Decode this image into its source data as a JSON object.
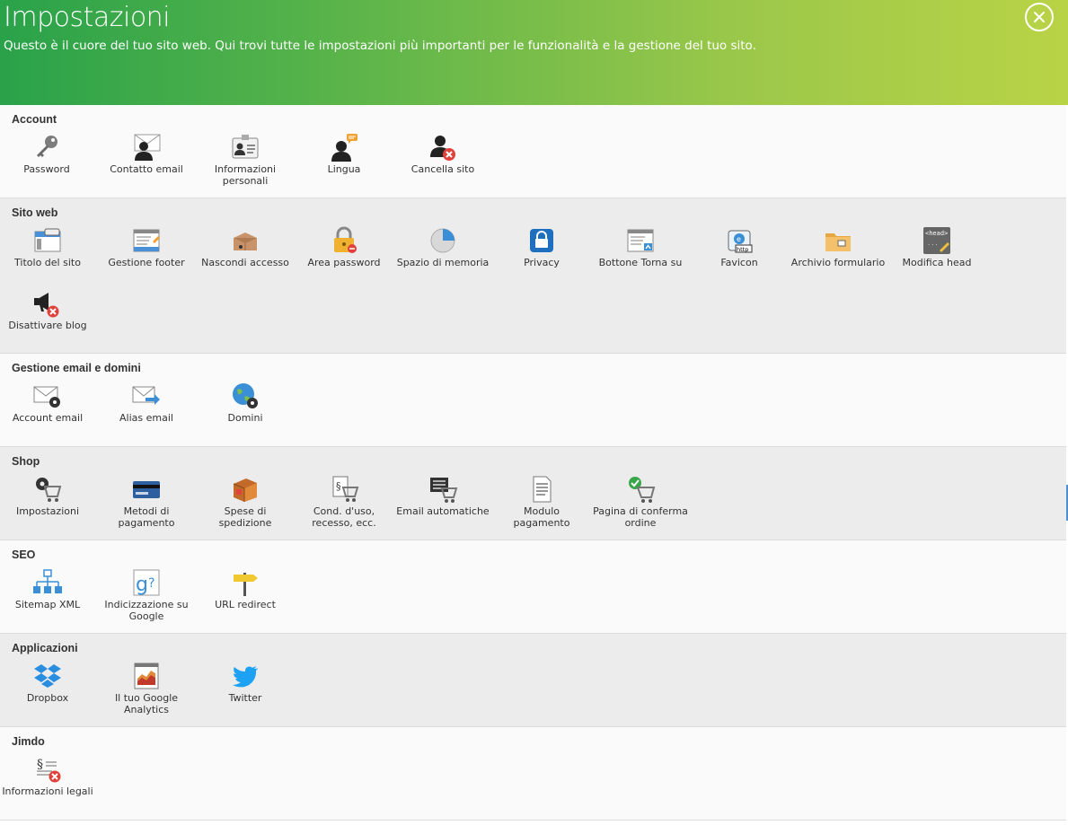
{
  "header": {
    "title": "Impostazioni",
    "subtitle": "Questo è il cuore del tuo sito web. Qui trovi tutte le impostazioni più importanti per le funzionalità e la gestione del tuo sito."
  },
  "sections": {
    "account": {
      "title": "Account",
      "items": [
        "Password",
        "Contatto email",
        "Informazioni personali",
        "Lingua",
        "Cancella sito"
      ]
    },
    "sito": {
      "title": "Sito web",
      "items": [
        "Titolo del sito",
        "Gestione footer",
        "Nascondi accesso",
        "Area password",
        "Spazio di memoria",
        "Privacy",
        "Bottone Torna su",
        "Favicon",
        "Archivio formulario",
        "Modifica head",
        "Disattivare blog"
      ]
    },
    "email": {
      "title": "Gestione email e domini",
      "items": [
        "Account email",
        "Alias email",
        "Domini"
      ]
    },
    "shop": {
      "title": "Shop",
      "items": [
        "Impostazioni",
        "Metodi di pagamento",
        "Spese di spedizione",
        "Cond. d'uso, recesso, ecc.",
        "Email automatiche",
        "Modulo pagamento",
        "Pagina di conferma ordine"
      ]
    },
    "seo": {
      "title": "SEO",
      "items": [
        "Sitemap XML",
        "Indicizzazione su Google",
        "URL redirect"
      ]
    },
    "apps": {
      "title": "Applicazioni",
      "items": [
        "Dropbox",
        "Il tuo Google Analytics",
        "Twitter"
      ]
    },
    "jimdo": {
      "title": "Jimdo",
      "items": [
        "Informazioni legali"
      ]
    }
  },
  "icons": {
    "account": [
      "key-icon",
      "user-mail-icon",
      "id-card-icon",
      "user-language-icon",
      "user-delete-icon"
    ],
    "sito": [
      "window-title-icon",
      "footer-icon",
      "hide-login-icon",
      "lock-icon",
      "pie-chart-icon",
      "privacy-lock-icon",
      "back-to-top-icon",
      "favicon-icon",
      "folder-icon",
      "head-code-icon",
      "megaphone-delete-icon"
    ],
    "email": [
      "mail-gear-icon",
      "mail-forward-icon",
      "globe-gear-icon"
    ],
    "shop": [
      "cart-gear-icon",
      "credit-card-icon",
      "parcel-icon",
      "cart-terms-icon",
      "cart-email-icon",
      "document-icon",
      "cart-check-icon"
    ],
    "seo": [
      "sitemap-icon",
      "google-search-icon",
      "signpost-icon"
    ],
    "apps": [
      "dropbox-icon",
      "analytics-icon",
      "twitter-icon"
    ],
    "jimdo": [
      "legal-delete-icon"
    ]
  },
  "colors": {
    "header_start": "#2aa24a",
    "header_end": "#b9d346",
    "alt_row": "#ececec",
    "delete_red": "#e0413a",
    "accent_blue": "#3a8fd6",
    "twitter_blue": "#1da1f2"
  }
}
